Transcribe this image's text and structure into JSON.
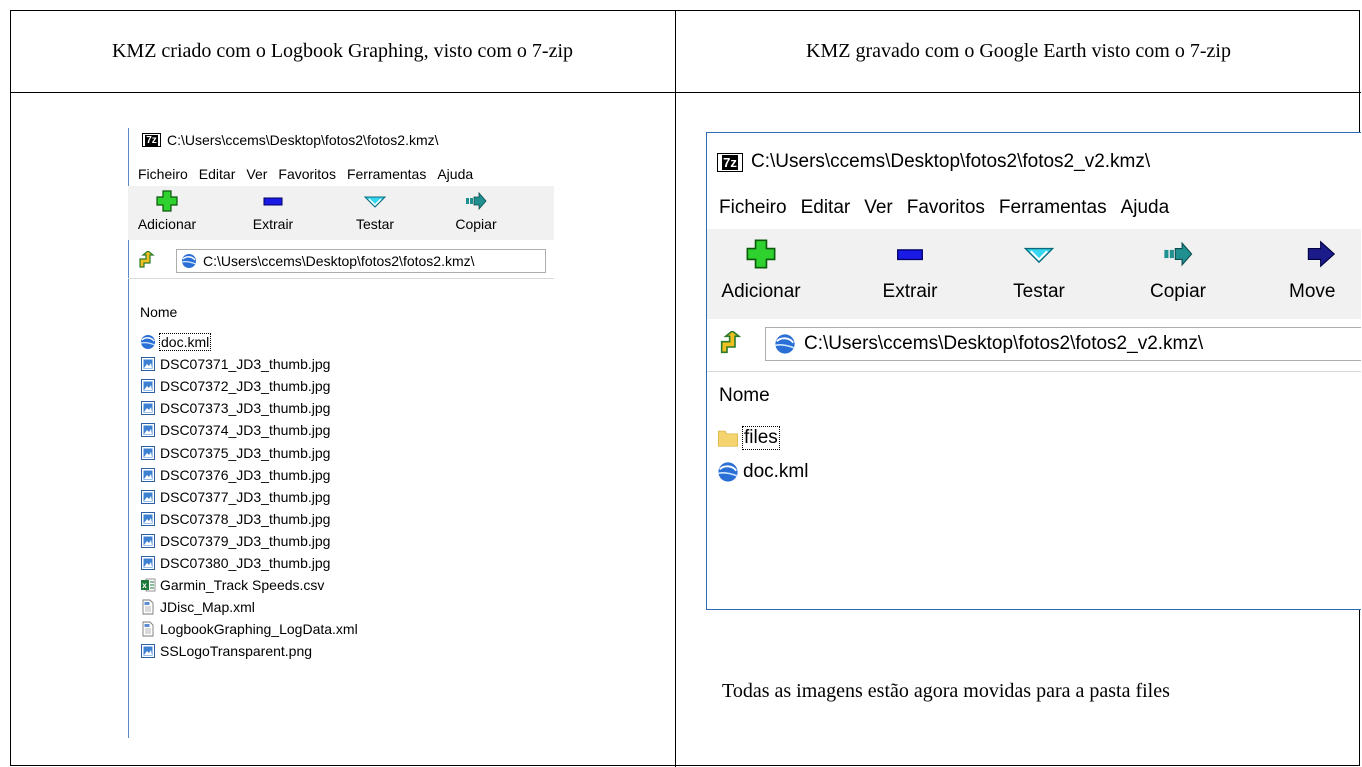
{
  "table": {
    "left_header": "KMZ criado com o Logbook Graphing, visto com o 7-zip",
    "right_header": "KMZ gravado com o Google Earth visto com o 7-zip",
    "caption": "Todas as imagens estão agora movidas para a pasta files"
  },
  "left_window": {
    "title": "C:\\Users\\ccems\\Desktop\\fotos2\\fotos2.kmz\\",
    "logo": "7z",
    "menu": [
      "Ficheiro",
      "Editar",
      "Ver",
      "Favoritos",
      "Ferramentas",
      "Ajuda"
    ],
    "toolbar": [
      "Adicionar",
      "Extrair",
      "Testar",
      "Copiar"
    ],
    "address": "C:\\Users\\ccems\\Desktop\\fotos2\\fotos2.kmz\\",
    "column_header": "Nome",
    "files": [
      {
        "name": "doc.kml",
        "icon": "google-earth-icon"
      },
      {
        "name": "DSC07371_JD3_thumb.jpg",
        "icon": "image-file-icon"
      },
      {
        "name": "DSC07372_JD3_thumb.jpg",
        "icon": "image-file-icon"
      },
      {
        "name": "DSC07373_JD3_thumb.jpg",
        "icon": "image-file-icon"
      },
      {
        "name": "DSC07374_JD3_thumb.jpg",
        "icon": "image-file-icon"
      },
      {
        "name": "DSC07375_JD3_thumb.jpg",
        "icon": "image-file-icon"
      },
      {
        "name": "DSC07376_JD3_thumb.jpg",
        "icon": "image-file-icon"
      },
      {
        "name": "DSC07377_JD3_thumb.jpg",
        "icon": "image-file-icon"
      },
      {
        "name": "DSC07378_JD3_thumb.jpg",
        "icon": "image-file-icon"
      },
      {
        "name": "DSC07379_JD3_thumb.jpg",
        "icon": "image-file-icon"
      },
      {
        "name": "DSC07380_JD3_thumb.jpg",
        "icon": "image-file-icon"
      },
      {
        "name": "Garmin_Track Speeds.csv",
        "icon": "excel-csv-icon"
      },
      {
        "name": "JDisc_Map.xml",
        "icon": "xml-file-icon"
      },
      {
        "name": "LogbookGraphing_LogData.xml",
        "icon": "xml-file-icon"
      },
      {
        "name": "SSLogoTransparent.png",
        "icon": "image-file-icon"
      }
    ]
  },
  "right_window": {
    "title": "C:\\Users\\ccems\\Desktop\\fotos2\\fotos2_v2.kmz\\",
    "logo": "7z",
    "menu": [
      "Ficheiro",
      "Editar",
      "Ver",
      "Favoritos",
      "Ferramentas",
      "Ajuda"
    ],
    "toolbar": [
      "Adicionar",
      "Extrair",
      "Testar",
      "Copiar",
      "Move"
    ],
    "address": "C:\\Users\\ccems\\Desktop\\fotos2\\fotos2_v2.kmz\\",
    "column_header": "Nome",
    "files": [
      {
        "name": "files",
        "icon": "folder-icon"
      },
      {
        "name": "doc.kml",
        "icon": "google-earth-icon"
      }
    ]
  },
  "colors": {
    "add_green": "#2fd12f",
    "extract_blue": "#1a1ae6",
    "test_cyan": "#35d6f0",
    "copy_teal": "#1f8f8f",
    "move_navy": "#1b1b8a",
    "window_border": "#2d6bb8",
    "folder_yellow": "#f5d470"
  }
}
